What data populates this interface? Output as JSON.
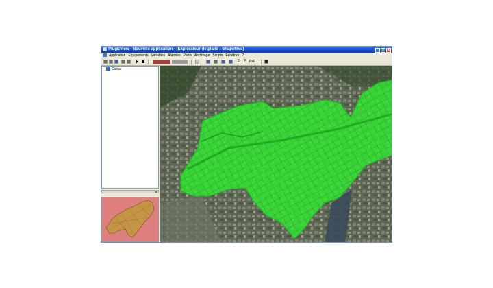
{
  "window": {
    "title": "PlugEView - Nouvelle application - [Explorateur de plans : Shapefiles]",
    "controls": [
      "_",
      "□",
      "x"
    ]
  },
  "menu": {
    "items": [
      "Application",
      "Equipements",
      "Variables",
      "Alarmes",
      "Plans",
      "Archivage",
      "Scripts",
      "Fenêtres",
      "?"
    ]
  },
  "toolbar": {
    "letters": [
      "P",
      "F",
      "PxF"
    ]
  },
  "tree": {
    "root_label": "Calcal"
  },
  "colors": {
    "zone_fill": "#33e633",
    "overview_background": "#e07f7f",
    "overview_zone": "#c49545",
    "title_bar": "#0a3fbf"
  },
  "icons": [
    "new-icon",
    "open-icon",
    "save-icon",
    "print-icon",
    "play-icon",
    "stop-icon",
    "zoom-icon",
    "layers-icon",
    "grid-icon",
    "terminal-icon"
  ]
}
